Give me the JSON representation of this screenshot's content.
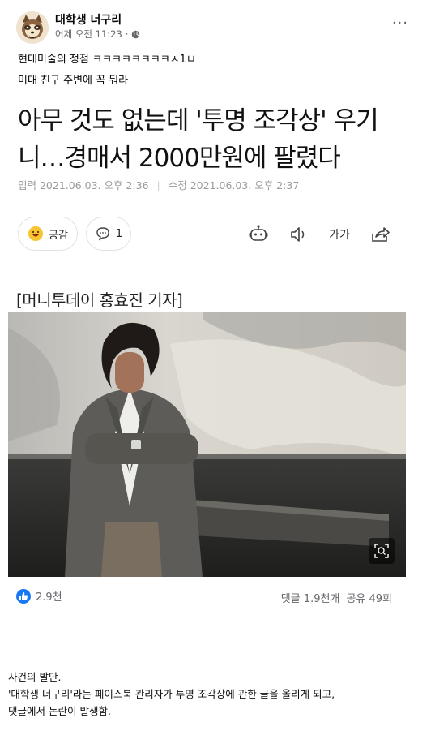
{
  "post": {
    "page_name": "대학생 너구리",
    "time": "어제 오전 11:23",
    "dot": "·",
    "more": "···",
    "caption_lines": [
      "현대미술의 정점 ㅋㅋㅋㅋㅋㅋㅋㅋㅅ1ㅂ",
      "미대 친구 주변에 꼭 둬라"
    ]
  },
  "article": {
    "headline_line1": "아무 것도 없는데 '투명 조각상' 우기",
    "headline_line2": "니…경매서 2000만원에 팔렸다",
    "published": "입력 2021.06.03. 오후 2:36",
    "modified": "수정 2021.06.03. 오후 2:37",
    "like_label": "공감",
    "comment_count": "1",
    "font_label": "가가",
    "byline": "[머니투데이 홍효진 기자]"
  },
  "reactions": {
    "likes": "2.9천",
    "comments": "댓글 1.9천개",
    "shares": "공유 49회"
  },
  "description": {
    "line1": "사건의 발단.",
    "line2": "'대학생 너구리'라는 페이스북 관리자가 투명 조각상에 관한 글을 올리게 되고,",
    "line3": "댓글에서 논란이 발생함."
  },
  "icons": [
    "globe-icon",
    "more-icon",
    "smile-emoji-icon",
    "comment-bubble-icon",
    "robot-icon",
    "speaker-icon",
    "share-icon",
    "zoom-icon",
    "like-thumb-icon"
  ],
  "colors": {
    "facebook_blue": "#1877f2",
    "meta_gray": "#65676b",
    "date_gray": "#9a9a9a"
  }
}
